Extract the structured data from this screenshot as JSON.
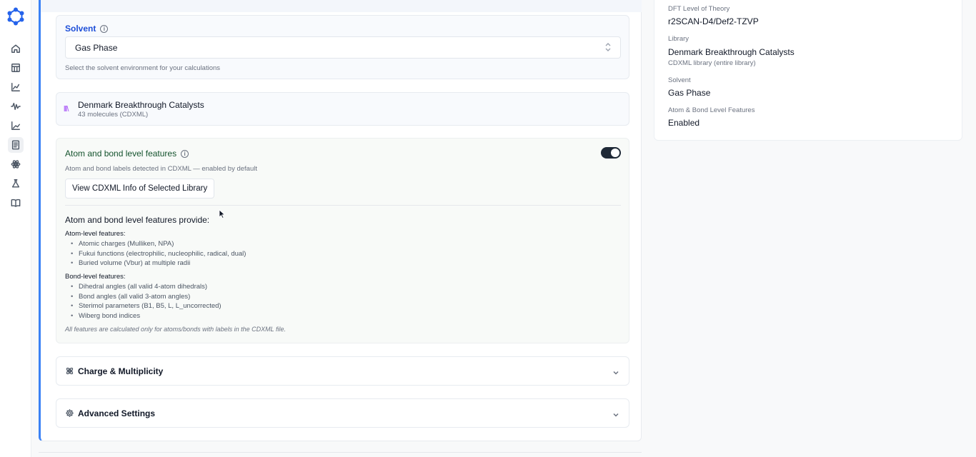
{
  "sidebar": {
    "icons": [
      "logo-icon",
      "home-icon",
      "table-icon",
      "chart-icon",
      "waveform-icon",
      "line-chart-icon",
      "document-icon",
      "atom-icon",
      "flask-icon",
      "book-icon"
    ]
  },
  "solvent": {
    "title": "Solvent",
    "selected": "Gas Phase",
    "helper": "Select the solvent environment for your calculations"
  },
  "library": {
    "name": "Denmark Breakthrough Catalysts",
    "subtitle": "43 molecules (CDXML)",
    "icon_glyph": "lll\\"
  },
  "features": {
    "title": "Atom and bond level features",
    "enabled": true,
    "subtitle": "Atom and bond labels detected in CDXML — enabled by default",
    "button_label": "View CDXML Info of Selected Library",
    "provide_heading": "Atom and bond level features provide:",
    "atom_heading": "Atom-level features:",
    "atom_items": [
      "Atomic charges (Mulliken, NPA)",
      "Fukui functions (electrophilic, nucleophilic, radical, dual)",
      "Buried volume (Vbur) at multiple radii"
    ],
    "bond_heading": "Bond-level features:",
    "bond_items": [
      "Dihedral angles (all valid 4-atom dihedrals)",
      "Bond angles (all valid 3-atom angles)",
      "Sterimol parameters (B1, B5, L, L_uncorrected)",
      "Wiberg bond indices"
    ],
    "note": "All features are calculated only for atoms/bonds with labels in the CDXML file."
  },
  "accordions": {
    "charge": "Charge & Multiplicity",
    "advanced": "Advanced Settings"
  },
  "summary": {
    "dft_label": "DFT Level of Theory",
    "dft_value": "r2SCAN-D4/Def2-TZVP",
    "library_label": "Library",
    "library_value": "Denmark Breakthrough Catalysts",
    "library_sub": "CDXML library (entire library)",
    "solvent_label": "Solvent",
    "solvent_value": "Gas Phase",
    "features_label": "Atom & Bond Level Features",
    "features_value": "Enabled"
  },
  "colors": {
    "accent": "#3b82f6",
    "solvent_title": "#1d4ed8",
    "features_title": "#14532d",
    "library_icon": "#a855f7"
  }
}
